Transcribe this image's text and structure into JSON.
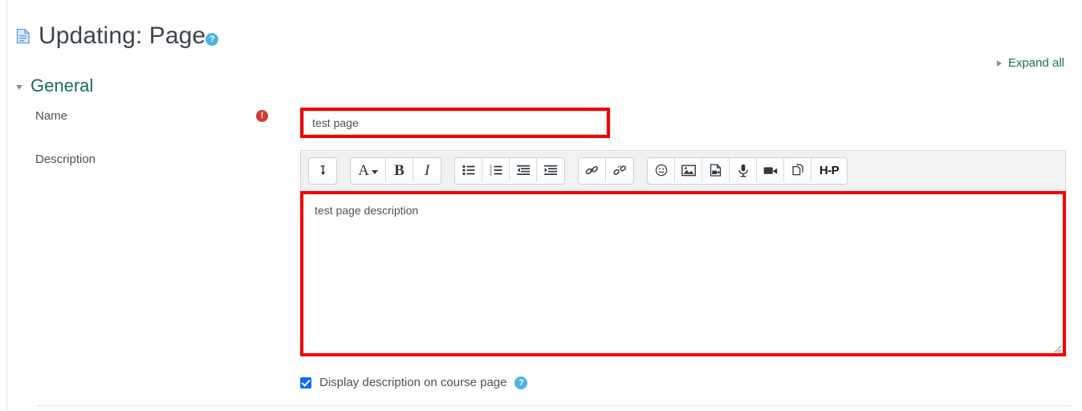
{
  "header": {
    "title": "Updating: Page",
    "page_icon": "page-document-icon",
    "help_icon_glyph": "?",
    "help_icon_color": "#4eb3e3"
  },
  "expand_all": {
    "label": "Expand all",
    "icon": "triangle-right-icon",
    "link_color": "#1f6f63"
  },
  "section": {
    "title": "General",
    "icon": "triangle-down-icon",
    "title_color": "#176b5f"
  },
  "form": {
    "name": {
      "label": "Name",
      "value": "test page",
      "placeholder": "",
      "required_icon": "required-exclamation-icon",
      "required_icon_glyph": "!",
      "required_icon_color": "#d03b32",
      "highlight_color": "#f40000"
    },
    "description": {
      "label": "Description",
      "value": "test page description",
      "highlight_color": "#f40000"
    },
    "display_description": {
      "label": "Display description on course page",
      "checked": true,
      "checkbox_color": "#0d6efd",
      "help_icon_glyph": "?"
    }
  },
  "editor_toolbar": {
    "groups": [
      {
        "name": "expand-group",
        "buttons": [
          {
            "name": "show-more-buttons",
            "icon": "arrow-turn-down-icon",
            "label": ""
          }
        ]
      },
      {
        "name": "format-group",
        "buttons": [
          {
            "name": "style-paragraph",
            "icon": "letter-a-dropdown-icon",
            "label": "A"
          },
          {
            "name": "bold",
            "icon": "bold-icon",
            "label": "B"
          },
          {
            "name": "italic",
            "icon": "italic-icon",
            "label": "I"
          }
        ]
      },
      {
        "name": "list-group",
        "buttons": [
          {
            "name": "bulleted-list",
            "icon": "bulleted-list-icon",
            "label": ""
          },
          {
            "name": "numbered-list",
            "icon": "numbered-list-icon",
            "label": ""
          },
          {
            "name": "outdent",
            "icon": "outdent-icon",
            "label": ""
          },
          {
            "name": "indent",
            "icon": "indent-icon",
            "label": ""
          }
        ]
      },
      {
        "name": "link-group",
        "buttons": [
          {
            "name": "insert-link",
            "icon": "link-icon",
            "label": ""
          },
          {
            "name": "remove-link",
            "icon": "unlink-icon",
            "label": ""
          }
        ]
      },
      {
        "name": "media-group",
        "buttons": [
          {
            "name": "insert-emoticon",
            "icon": "smiley-icon",
            "label": ""
          },
          {
            "name": "insert-image",
            "icon": "image-icon",
            "label": ""
          },
          {
            "name": "insert-media",
            "icon": "media-file-icon",
            "label": ""
          },
          {
            "name": "record-audio",
            "icon": "microphone-icon",
            "label": ""
          },
          {
            "name": "record-video",
            "icon": "video-camera-icon",
            "label": ""
          },
          {
            "name": "manage-files",
            "icon": "files-copy-icon",
            "label": ""
          },
          {
            "name": "insert-h5p",
            "icon": "h5p-icon",
            "label": "H-P"
          }
        ]
      }
    ]
  }
}
